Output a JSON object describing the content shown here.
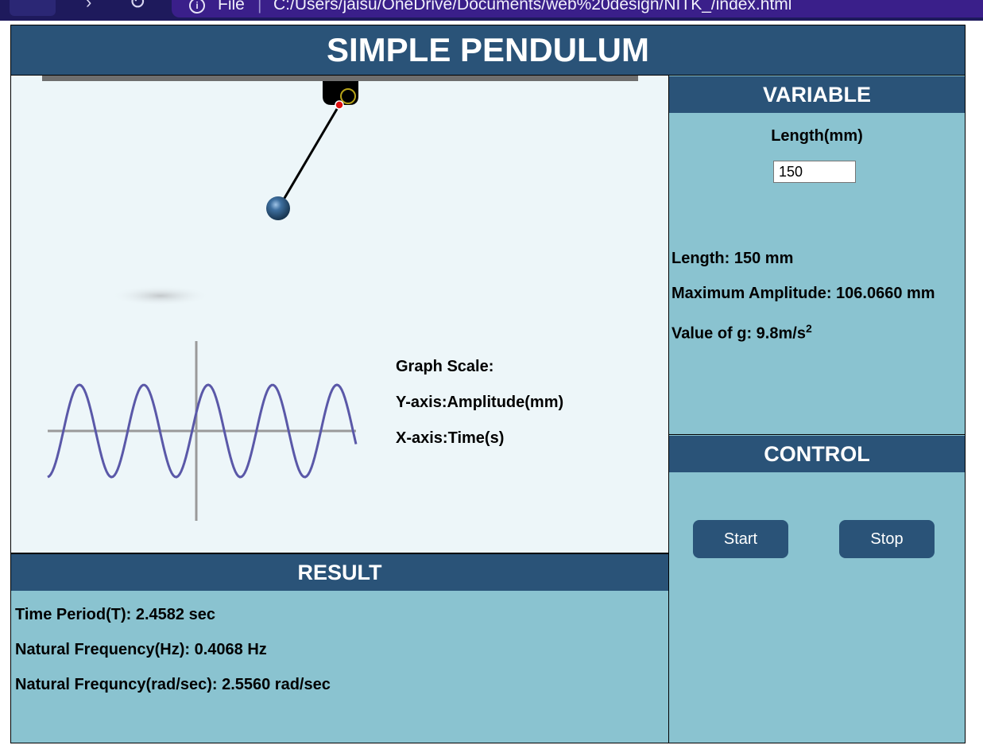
{
  "browser": {
    "address_prefix": "File",
    "url": "C:/Users/jaisu/OneDrive/Documents/web%20design/NITK_/index.html"
  },
  "app": {
    "title": "SIMPLE PENDULUM"
  },
  "graph": {
    "heading": "Graph Scale:",
    "y_axis": "Y-axis:Amplitude(mm)",
    "x_axis": "X-axis:Time(s)"
  },
  "result": {
    "title": "RESULT",
    "time_period": "Time Period(T): 2.4582 sec",
    "natural_frequency_hz": "Natural Frequency(Hz): 0.4068 Hz",
    "natural_frequency_rad": "Natural Frequncy(rad/sec): 2.5560 rad/sec"
  },
  "variable": {
    "title": "VARIABLE",
    "length_label": "Length(mm)",
    "length_value": "150",
    "length_info": "Length: 150 mm",
    "max_amplitude": "Maximum Amplitude: 106.0660 mm",
    "g_label": "Value of g: 9.8m/s",
    "g_exponent": "2"
  },
  "control": {
    "title": "CONTROL",
    "start_label": "Start",
    "stop_label": "Stop"
  },
  "colors": {
    "header_blue": "#2a5378",
    "panel_teal": "#8ac3d0",
    "canvas_bg": "#edf6f9",
    "wave_purple": "#5a58a8",
    "pivot_red": "#e01010"
  }
}
